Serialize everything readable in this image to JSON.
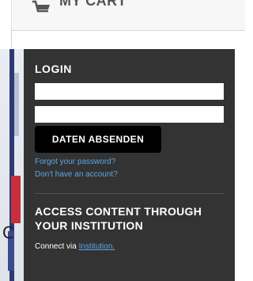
{
  "cart": {
    "label": "MY CART",
    "icon": "cart-icon"
  },
  "hero": {
    "partial_letter": "C"
  },
  "login": {
    "title": "LOGIN",
    "username_value": "",
    "password_value": "",
    "submit_label": "DATEN ABSENDEN",
    "forgot_link": "Forgot your password?",
    "signup_link": "Don't have an account?"
  },
  "institution": {
    "title": "ACCESS CONTENT THROUGH YOUR INSTITUTION",
    "connect_prefix": "Connect via",
    "connect_link": "Institution."
  },
  "colors": {
    "panel_bg": "#333333",
    "link": "#5aa6e8",
    "button_bg": "#000000"
  }
}
